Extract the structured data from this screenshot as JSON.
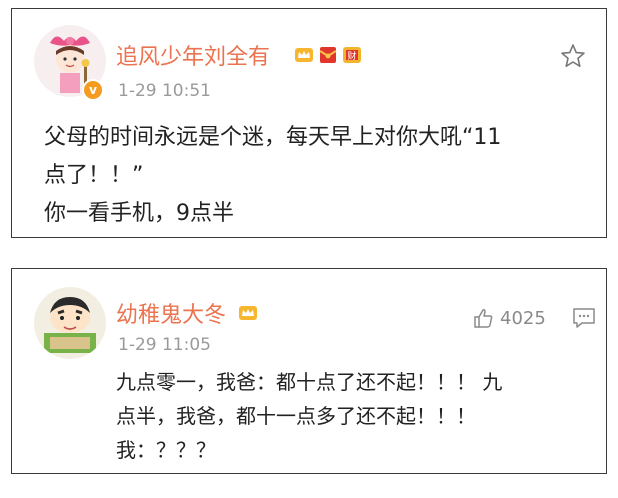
{
  "post": {
    "username": "追风少年刘全有",
    "timestamp": "1-29 10:51",
    "lines": [
      "父母的时间永远是个迷，每天早上对你大吼“11",
      "点了！！”",
      "你一看手机，9点半"
    ],
    "badges": [
      "crown-badge-icon",
      "red-envelope-badge-icon",
      "fortune-badge-icon"
    ],
    "colors": {
      "username": "#eb7350",
      "timestamp": "#9a9a9a",
      "vbadge": "#f39c1f"
    }
  },
  "comment": {
    "username": "幼稚鬼大冬",
    "timestamp": "1-29 11:05",
    "like_count": "4025",
    "lines": [
      "九点零一，我爸：都十点了还不起！！！ 九",
      "点半，我爸，都十一点多了还不起！！！",
      "我：？？？"
    ],
    "badges": [
      "crown-badge-icon"
    ]
  }
}
